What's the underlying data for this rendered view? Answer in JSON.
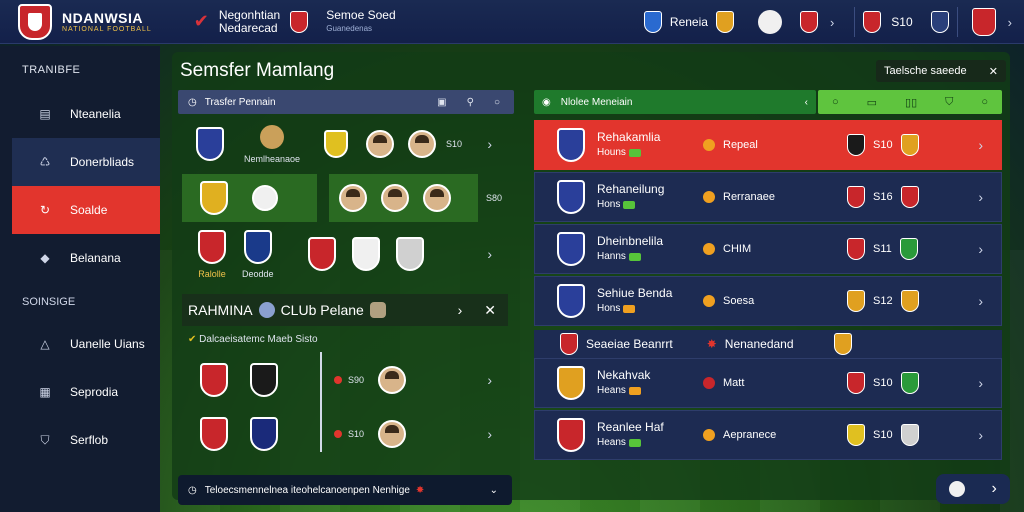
{
  "topbar": {
    "brand": "NDANWSIA",
    "brand_sub": "NATIONAL FOOTBALL",
    "link1_line1": "Negonhtian",
    "link1_line2": "Nedarecad",
    "link2_line1": "Semoe Soed",
    "link2_line2": "Guanedenas",
    "right_team": "Reneia",
    "score": "S10"
  },
  "sidebar": {
    "heading": "TRANIBFE",
    "items": [
      {
        "label": "Nteanelia",
        "icon": "chart-icon"
      },
      {
        "label": "Donerbliads",
        "icon": "shirt-icon"
      },
      {
        "label": "Soalde",
        "icon": "refresh-icon"
      },
      {
        "label": "Belanana",
        "icon": "whistle-icon"
      }
    ],
    "heading2": "SOINSIGE",
    "items2": [
      {
        "label": "Uanelle Uians",
        "icon": "warning-icon"
      },
      {
        "label": "Seprodia",
        "icon": "ledger-icon"
      },
      {
        "label": "Serflob",
        "icon": "shield-icon"
      }
    ]
  },
  "main": {
    "title": "Semsfer Mamlang",
    "settings_label": "Taelsche saeede",
    "transfer_header": "Trasfer Pennain",
    "row1_label": "Nemlheanaoe",
    "row1_score": "S10",
    "row2_score": "S80",
    "row3_label_a": "Ralolle",
    "row3_label_b": "Deodde",
    "club_title": "RAHMINA",
    "club_name": "CLUb Pelane",
    "club_sub": "Dalcaeisatemc Maeb Sisto",
    "club_score1": "S90",
    "club_score2": "S10",
    "bottom_label": "Teloecsmennelnea iteohelcanoenpen Nenhige"
  },
  "right": {
    "header": "Nlolee Meneiain",
    "cards": [
      {
        "name": "Rehakamlia",
        "sub": "Houns",
        "opp": "Repeal",
        "score": "S10",
        "style": "red"
      },
      {
        "name": "Rehaneilung",
        "sub": "Hons",
        "opp": "Rerranaee",
        "score": "S16",
        "style": "navy"
      },
      {
        "name": "Dheinbnelila",
        "sub": "Hanns",
        "opp": "CHIM",
        "score": "S11",
        "style": "navy"
      },
      {
        "name": "Sehiue Benda",
        "sub": "Hons",
        "opp": "Soesa",
        "score": "S12",
        "style": "navy"
      },
      {
        "name": "Nekahvak",
        "sub": "Heans",
        "opp": "Matt",
        "score": "S10",
        "style": "navy"
      },
      {
        "name": "Reanlee Haf",
        "sub": "Heans",
        "opp": "Aepranece",
        "score": "S10",
        "style": "navy"
      }
    ],
    "fixture_left": "Seaeiae Beanrrt",
    "fixture_right": "Nenanedand"
  },
  "colors": {
    "accent_red": "#e2352d",
    "navy": "#1d2b52",
    "green_bar": "#1f7a2c",
    "lime": "#5fc43e"
  }
}
